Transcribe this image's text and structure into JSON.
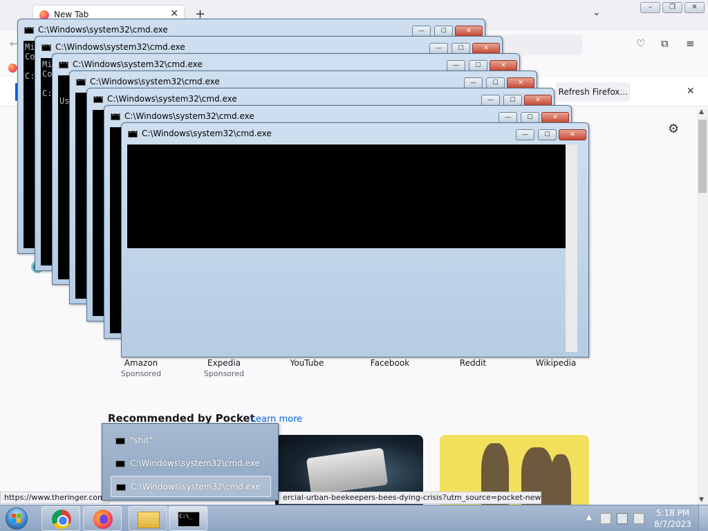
{
  "firefox": {
    "tab_title": "New Tab",
    "tab_close": "✕",
    "new_tab": "+",
    "list_tabs": "⌄",
    "win_min": "–",
    "win_restore": "❐",
    "win_close": "✕",
    "notification": {
      "refresh_label": "Refresh Firefox…",
      "close": "✕"
    },
    "shortcuts": [
      {
        "label": "Amazon",
        "sub": "Sponsored"
      },
      {
        "label": "Expedia",
        "sub": "Sponsored"
      },
      {
        "label": "YouTube",
        "sub": ""
      },
      {
        "label": "Facebook",
        "sub": ""
      },
      {
        "label": "Reddit",
        "sub": ""
      },
      {
        "label": "Wikipedia",
        "sub": ""
      }
    ],
    "pocket": {
      "heading": "Recommended by Pocket",
      "learn_more": "Learn more"
    },
    "status_url": "https://www.theringer.com",
    "status_url_2": "ercial-urban-beekeepers-bees-dying-crisis?utm_source=pocket-newtab"
  },
  "cmd_windows": [
    {
      "title": "C:\\Windows\\system32\\cmd.exe",
      "lines": [
        "Mi",
        "Co",
        "",
        "C:"
      ]
    },
    {
      "title": "C:\\Windows\\system32\\cmd.exe",
      "lines": [
        "Mi",
        "Co",
        "",
        "C:"
      ]
    },
    {
      "title": "C:\\Windows\\system32\\cmd.exe",
      "lines": [
        "",
        "",
        "Us"
      ]
    },
    {
      "title": "C:\\Windows\\system32\\cmd.exe",
      "lines": []
    },
    {
      "title": "C:\\Windows\\system32\\cmd.exe",
      "lines": []
    },
    {
      "title": "C:\\Windows\\system32\\cmd.exe",
      "lines": []
    },
    {
      "title": "C:\\Windows\\system32\\cmd.exe",
      "lines": []
    }
  ],
  "cmd_buttons": {
    "min": "—",
    "max": "☐",
    "close": "✕"
  },
  "jumplist": [
    {
      "label": "\"shit\""
    },
    {
      "label": "C:\\Windows\\system32\\cmd.exe"
    },
    {
      "label": "C:\\Windows\\system32\\cmd.exe"
    }
  ],
  "taskbar": {
    "clock_time": "5:18 PM",
    "clock_date": "8/7/2023",
    "tray_arrow": "▲",
    "cmd_glyph": "C:\\_"
  },
  "colors": {
    "cmd_title_bar": "#b6cce3",
    "cmd_close": "#c74a34",
    "taskbar": "#8ea5c2",
    "firefox_accent": "#0060df"
  }
}
